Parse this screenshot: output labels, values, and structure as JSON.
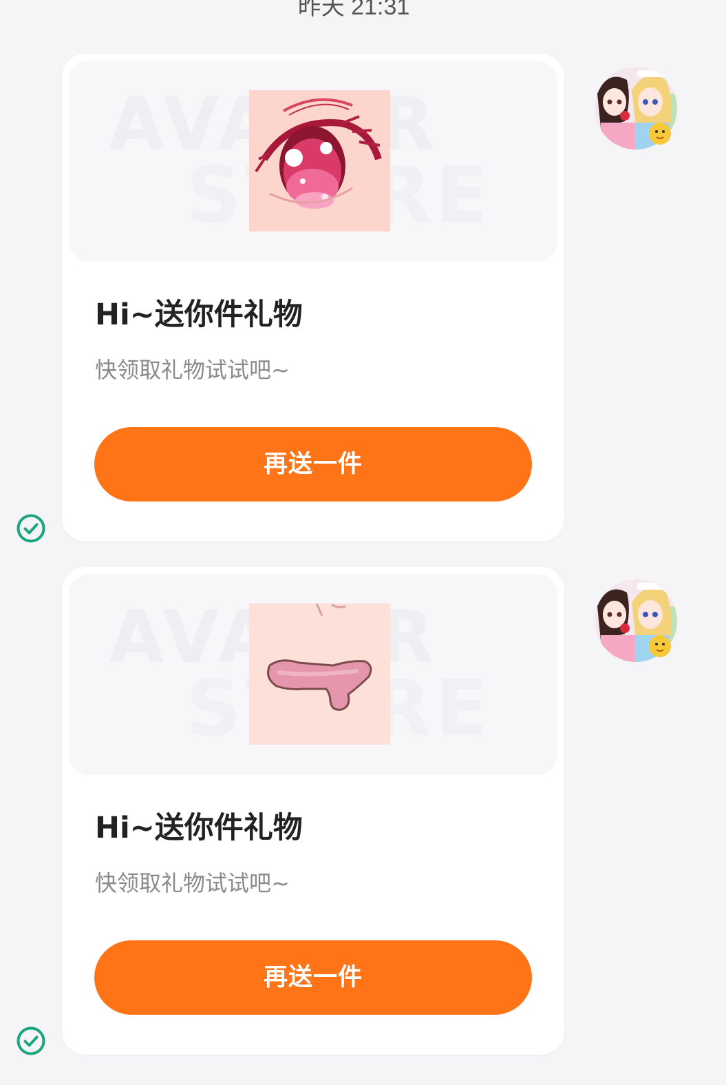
{
  "chat": {
    "timestamp": "昨天 21:31",
    "messages": [
      {
        "title": "Hi~送你件礼物",
        "subtitle": "快领取礼物试试吧~",
        "button_label": "再送一件",
        "banner_watermark_line1": "AVATAR",
        "banner_watermark_line2": "STORE",
        "gift_icon": "anime-eye-icon",
        "sender_avatar": "anime-girls-avatar",
        "status_icon": "check-circle-icon"
      },
      {
        "title": "Hi~送你件礼物",
        "subtitle": "快领取礼物试试吧~",
        "button_label": "再送一件",
        "banner_watermark_line1": "AVATAR",
        "banner_watermark_line2": "STORE",
        "gift_icon": "anime-mouth-icon",
        "sender_avatar": "anime-girls-avatar",
        "status_icon": "check-circle-icon"
      }
    ]
  },
  "colors": {
    "background": "#f5f5f7",
    "card": "#ffffff",
    "button": "#ff7417",
    "button_text": "#ffffff",
    "title": "#222222",
    "subtitle": "#8a8a8a",
    "check": "#1aa57a"
  }
}
